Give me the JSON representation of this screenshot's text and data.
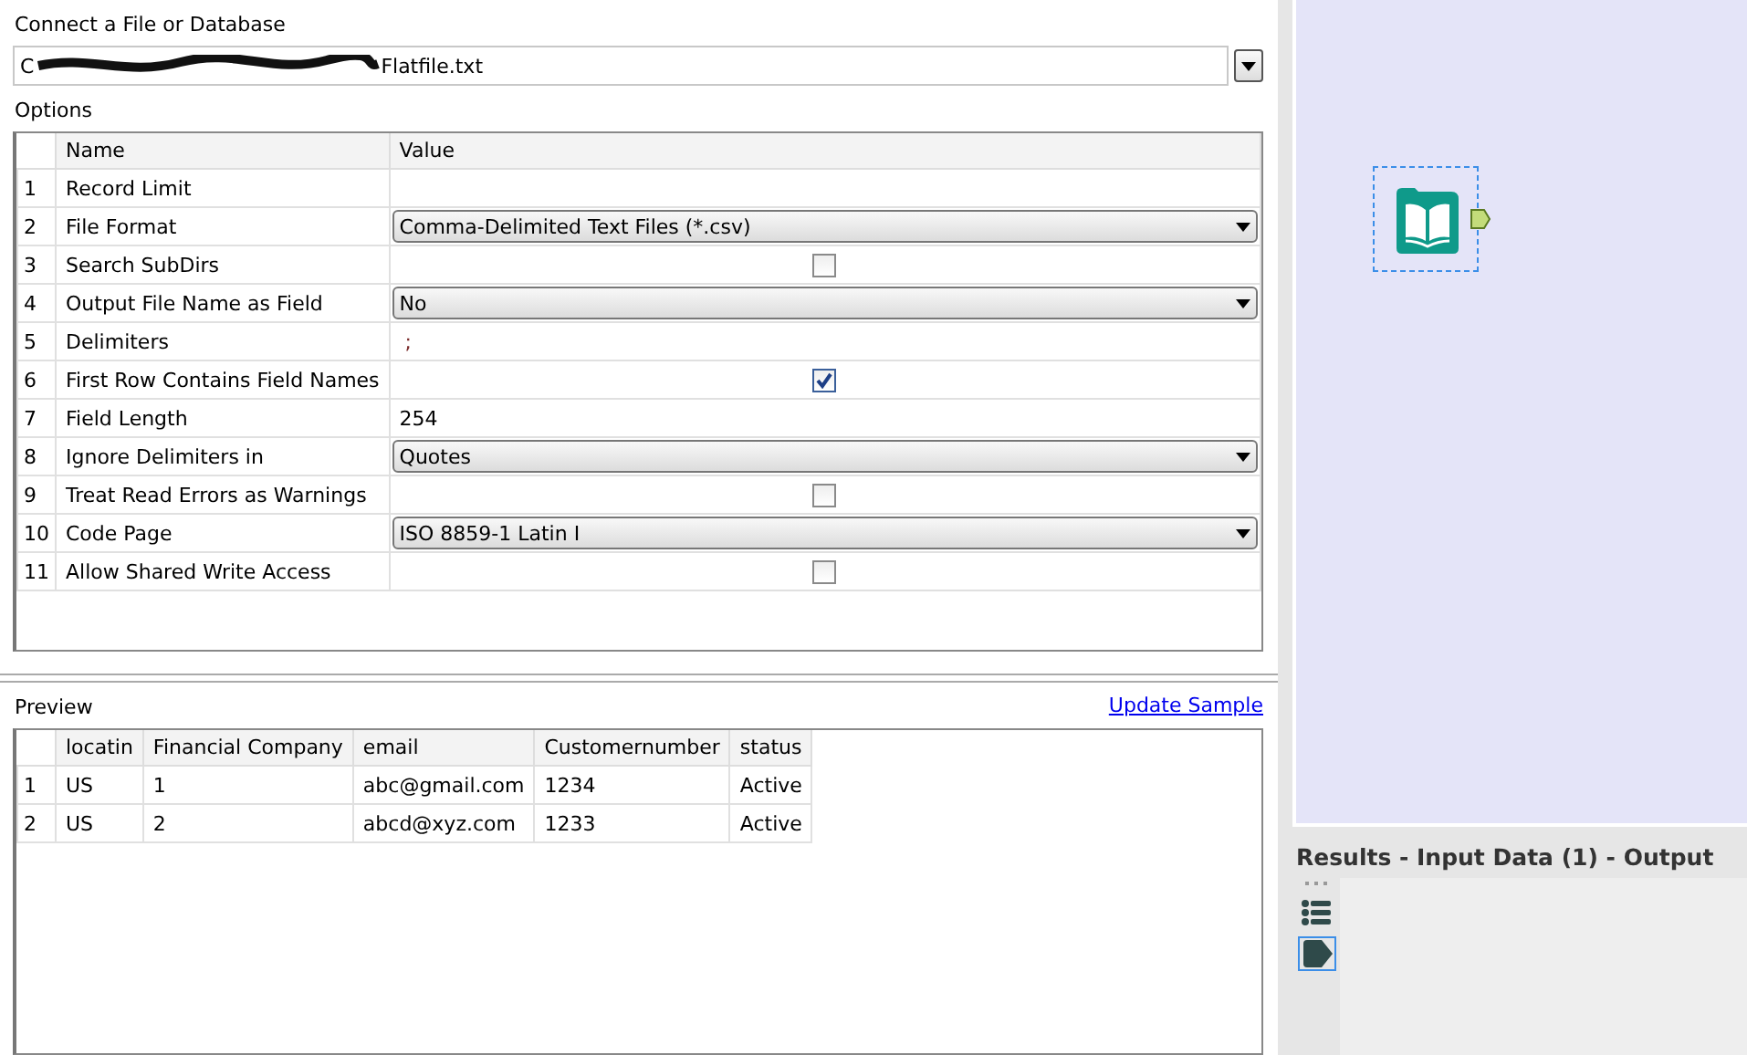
{
  "connect": {
    "label": "Connect a File or Database",
    "path_start": "C",
    "path_end": "Flatfile.txt"
  },
  "options": {
    "label": "Options",
    "columns": [
      "Name",
      "Value"
    ],
    "rows": [
      {
        "num": "1",
        "name": "Record Limit",
        "kind": "text",
        "value": ""
      },
      {
        "num": "2",
        "name": "File Format",
        "kind": "dropdown",
        "value": "Comma-Delimited Text Files (*.csv)"
      },
      {
        "num": "3",
        "name": "Search SubDirs",
        "kind": "checkbox",
        "checked": false
      },
      {
        "num": "4",
        "name": "Output File Name as Field",
        "kind": "dropdown",
        "value": "No"
      },
      {
        "num": "5",
        "name": "Delimiters",
        "kind": "text",
        "value": ";"
      },
      {
        "num": "6",
        "name": "First Row Contains Field Names",
        "kind": "checkbox",
        "checked": true
      },
      {
        "num": "7",
        "name": "Field Length",
        "kind": "text",
        "value": "254"
      },
      {
        "num": "8",
        "name": "Ignore Delimiters in",
        "kind": "dropdown",
        "value": "Quotes"
      },
      {
        "num": "9",
        "name": "Treat Read Errors as Warnings",
        "kind": "checkbox",
        "checked": false
      },
      {
        "num": "10",
        "name": "Code Page",
        "kind": "dropdown",
        "value": "ISO 8859-1 Latin I"
      },
      {
        "num": "11",
        "name": "Allow Shared Write Access",
        "kind": "checkbox",
        "checked": false
      }
    ]
  },
  "preview": {
    "label": "Preview",
    "update_link": "Update Sample",
    "columns": [
      "locatin",
      "Financial Company",
      "email",
      "Customernumber",
      "status"
    ],
    "rows": [
      {
        "num": "1",
        "cells": [
          "US",
          "1",
          "abc@gmail.com",
          "1234",
          "Active"
        ]
      },
      {
        "num": "2",
        "cells": [
          "US",
          "2",
          "abcd@xyz.com",
          "1233",
          "Active"
        ]
      }
    ]
  },
  "results": {
    "title": "Results - Input Data (1) - Output",
    "tools": [
      {
        "kind": "list",
        "selected": false
      },
      {
        "kind": "tag",
        "selected": true
      }
    ]
  }
}
